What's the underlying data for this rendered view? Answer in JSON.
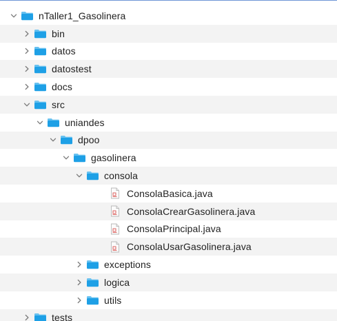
{
  "tree": {
    "items": [
      {
        "label": "nTaller1_Gasolinera",
        "type": "folder",
        "expanded": true,
        "depth": 0
      },
      {
        "label": "bin",
        "type": "folder",
        "expanded": false,
        "depth": 1
      },
      {
        "label": "datos",
        "type": "folder",
        "expanded": false,
        "depth": 1
      },
      {
        "label": "datostest",
        "type": "folder",
        "expanded": false,
        "depth": 1
      },
      {
        "label": "docs",
        "type": "folder",
        "expanded": false,
        "depth": 1
      },
      {
        "label": "src",
        "type": "folder",
        "expanded": true,
        "depth": 1
      },
      {
        "label": "uniandes",
        "type": "folder",
        "expanded": true,
        "depth": 2
      },
      {
        "label": "dpoo",
        "type": "folder",
        "expanded": true,
        "depth": 3
      },
      {
        "label": "gasolinera",
        "type": "folder",
        "expanded": true,
        "depth": 4
      },
      {
        "label": "consola",
        "type": "folder",
        "expanded": true,
        "depth": 5
      },
      {
        "label": "ConsolaBasica.java",
        "type": "file",
        "depth": 6
      },
      {
        "label": "ConsolaCrearGasolinera.java",
        "type": "file",
        "depth": 6
      },
      {
        "label": "ConsolaPrincipal.java",
        "type": "file",
        "depth": 6
      },
      {
        "label": "ConsolaUsarGasolinera.java",
        "type": "file",
        "depth": 6
      },
      {
        "label": "exceptions",
        "type": "folder",
        "expanded": false,
        "depth": 5
      },
      {
        "label": "logica",
        "type": "folder",
        "expanded": false,
        "depth": 5
      },
      {
        "label": "utils",
        "type": "folder",
        "expanded": false,
        "depth": 5
      },
      {
        "label": "tests",
        "type": "folder",
        "expanded": false,
        "depth": 1
      }
    ]
  },
  "colors": {
    "folder": "#1ea0e6",
    "folder_tab": "#67c1f0",
    "chevron": "#7a7a7a",
    "alt_row": "#f3f3f3",
    "file_accent": "#d9534f"
  },
  "icons": {
    "folder": "folder-icon",
    "file": "java-file-icon",
    "expanded": "chevron-down-icon",
    "collapsed": "chevron-right-icon"
  }
}
